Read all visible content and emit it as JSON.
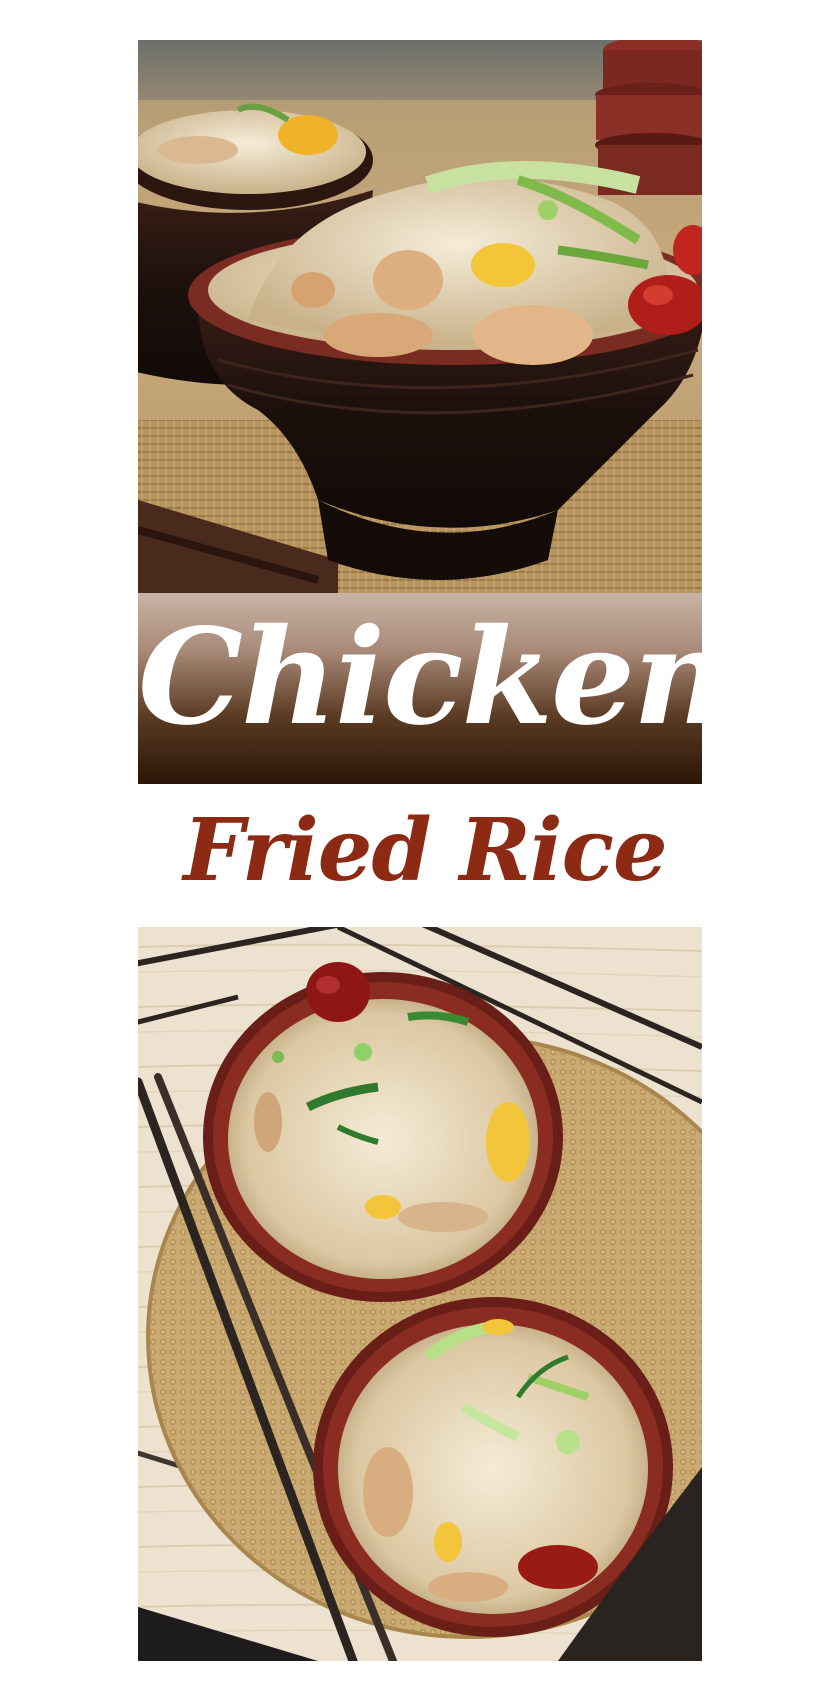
{
  "pin": {
    "title_line1": "Chicken",
    "title_line2": "Fried Rice"
  },
  "images": {
    "top_photo": "side-view-bowls-of-chicken-fried-rice",
    "bottom_photo": "overhead-view-two-bowls-with-chopsticks-on-woven-mat"
  },
  "colors": {
    "title_white": "#ffffff",
    "subtitle_brown": "#8c2a14",
    "banner_dark": "#2b1608",
    "bowl_red": "#7a2a1e",
    "mat_tan": "#c9aa72"
  }
}
